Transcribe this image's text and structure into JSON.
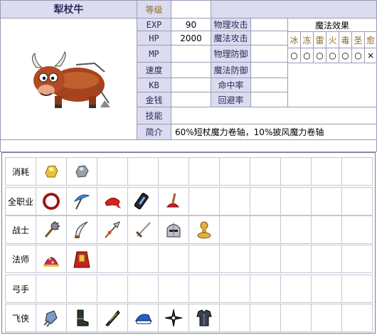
{
  "monster": {
    "name": "犁杖牛",
    "level_label": "等级",
    "level_value": "",
    "exp_label": "EXP",
    "exp_value": "90",
    "hp_label": "HP",
    "hp_value": "2000",
    "mp_label": "MP",
    "mp_value": "",
    "speed_label": "速度",
    "speed_value": "",
    "kb_label": "KB",
    "kb_value": "",
    "money_label": "金钱",
    "money_value": "",
    "skill_label": "技能",
    "skill_value": "",
    "intro_label": "简介",
    "intro_value": "60%短杖魔力卷轴，10%披风魔力卷轴"
  },
  "stats": {
    "phys_atk_label": "物理攻击",
    "phys_atk_value": "",
    "mag_atk_label": "魔法攻击",
    "mag_atk_value": "",
    "phys_def_label": "物理防御",
    "phys_def_value": "",
    "mag_def_label": "魔法防御",
    "mag_def_value": "",
    "accuracy_label": "命中率",
    "accuracy_value": "",
    "evasion_label": "回避率",
    "evasion_value": ""
  },
  "magic": {
    "title": "魔法效果",
    "elements": [
      "冰",
      "冻",
      "雷",
      "火",
      "毒",
      "圣",
      "愈"
    ],
    "effects": [
      "○",
      "○",
      "○",
      "○",
      "○",
      "○",
      "×"
    ]
  },
  "drops": {
    "rows": [
      {
        "label": "消耗",
        "items": [
          "gold-ore-icon",
          "silver-ore-icon"
        ]
      },
      {
        "label": "全职业",
        "items": [
          "red-ring-icon",
          "blue-umbrella-icon",
          "red-bandana-icon",
          "black-scroll-icon",
          "plunger-icon"
        ]
      },
      {
        "label": "战士",
        "items": [
          "spiked-mace-icon",
          "curved-blade-icon",
          "halberd-icon",
          "long-sword-icon",
          "steel-helmet-icon",
          "gold-stamp-icon"
        ]
      },
      {
        "label": "法师",
        "items": [
          "wizard-hat-icon",
          "red-robe-icon"
        ]
      },
      {
        "label": "弓手",
        "items": []
      },
      {
        "label": "飞侠",
        "items": [
          "claw-glove-icon",
          "dark-boots-icon",
          "feather-dagger-icon",
          "blue-cap-icon",
          "throwing-star-icon",
          "dark-armor-icon"
        ]
      }
    ]
  },
  "colors": {
    "header_bg": "#dcdcf0",
    "border": "#9a9ab4"
  }
}
